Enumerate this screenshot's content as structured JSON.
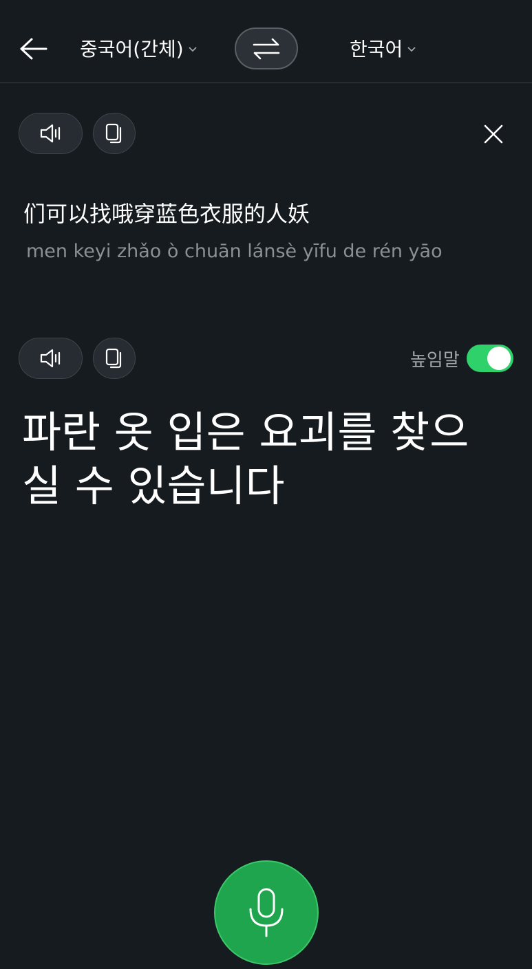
{
  "header": {
    "source_language": "중국어(간체)",
    "target_language": "한국어"
  },
  "source": {
    "text": "们可以找哦穿蓝色衣服的人妖",
    "pinyin": "men keyi zhǎo ò chuān lánsè yīfu de rén yāo"
  },
  "result": {
    "honorific_label": "높임말",
    "honorific_enabled": true,
    "text": "파란 옷 입은 요괴를 찾으실 수 있습니다"
  },
  "colors": {
    "background": "#161b1f",
    "toggle_on": "#2fd16b",
    "mic": "#1fa54d"
  },
  "icons": {
    "back": "arrow-left-icon",
    "swap": "swap-arrows-icon",
    "speaker": "speaker-icon",
    "copy": "copy-icon",
    "close": "close-icon",
    "mic": "microphone-icon"
  }
}
